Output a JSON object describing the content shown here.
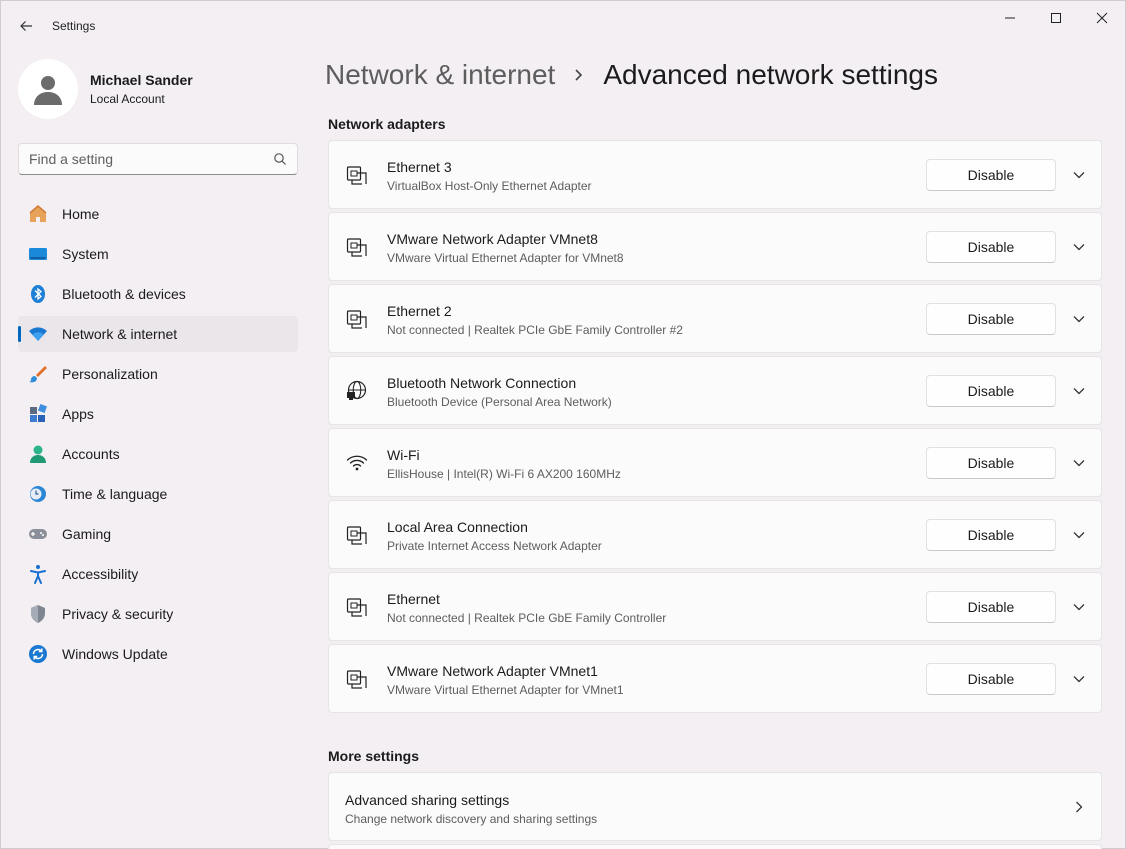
{
  "window": {
    "app_title": "Settings"
  },
  "profile": {
    "name": "Michael Sander",
    "account_type": "Local Account"
  },
  "search": {
    "placeholder": "Find a setting",
    "value": ""
  },
  "nav": {
    "items": [
      {
        "label": "Home",
        "icon": "home-icon"
      },
      {
        "label": "System",
        "icon": "system-icon"
      },
      {
        "label": "Bluetooth & devices",
        "icon": "bluetooth-icon"
      },
      {
        "label": "Network & internet",
        "icon": "network-icon",
        "active": true
      },
      {
        "label": "Personalization",
        "icon": "brush-icon"
      },
      {
        "label": "Apps",
        "icon": "apps-icon"
      },
      {
        "label": "Accounts",
        "icon": "accounts-icon"
      },
      {
        "label": "Time & language",
        "icon": "time-language-icon"
      },
      {
        "label": "Gaming",
        "icon": "gaming-icon"
      },
      {
        "label": "Accessibility",
        "icon": "accessibility-icon"
      },
      {
        "label": "Privacy & security",
        "icon": "shield-icon"
      },
      {
        "label": "Windows Update",
        "icon": "windows-update-icon"
      }
    ]
  },
  "breadcrumb": {
    "parent": "Network & internet",
    "current": "Advanced network settings"
  },
  "adapters_section": {
    "title": "Network adapters",
    "disable_label": "Disable",
    "items": [
      {
        "name": "Ethernet 3",
        "detail": "VirtualBox Host-Only Ethernet Adapter",
        "icon": "ethernet-icon"
      },
      {
        "name": "VMware Network Adapter VMnet8",
        "detail": "VMware Virtual Ethernet Adapter for VMnet8",
        "icon": "ethernet-icon"
      },
      {
        "name": "Ethernet 2",
        "detail": "Not connected | Realtek PCIe GbE Family Controller #2",
        "icon": "ethernet-icon"
      },
      {
        "name": "Bluetooth Network Connection",
        "detail": "Bluetooth Device (Personal Area Network)",
        "icon": "globe-network-icon"
      },
      {
        "name": "Wi-Fi",
        "detail": "EllisHouse  | Intel(R) Wi-Fi 6 AX200 160MHz",
        "icon": "wifi-icon"
      },
      {
        "name": "Local Area Connection",
        "detail": "Private Internet Access Network Adapter",
        "icon": "ethernet-icon"
      },
      {
        "name": "Ethernet",
        "detail": "Not connected | Realtek PCIe GbE Family Controller",
        "icon": "ethernet-icon"
      },
      {
        "name": "VMware Network Adapter VMnet1",
        "detail": "VMware Virtual Ethernet Adapter for VMnet1",
        "icon": "ethernet-icon"
      }
    ]
  },
  "more_settings": {
    "title": "More settings",
    "items": [
      {
        "name": "Advanced sharing settings",
        "detail": "Change network discovery and sharing settings"
      }
    ]
  },
  "colors": {
    "accent": "#0067c0",
    "window_bg": "#f3eff3",
    "card_bg": "#fbfbfb"
  }
}
